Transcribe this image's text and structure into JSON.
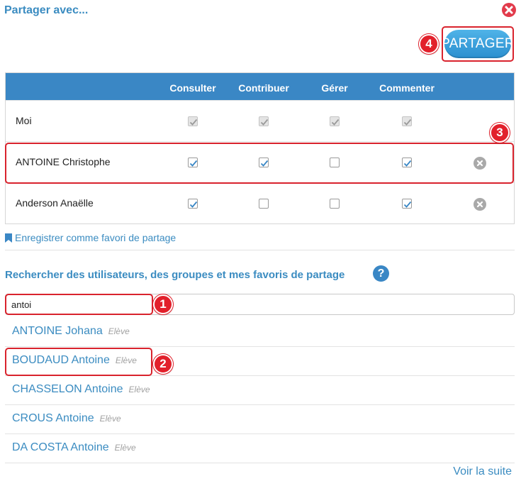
{
  "dialog": {
    "title": "Partager avec...",
    "share_label": "PARTAGER"
  },
  "table": {
    "columns": [
      "Consulter",
      "Contribuer",
      "Gérer",
      "Commenter"
    ],
    "rows": [
      {
        "name": "Moi",
        "perms": [
          true,
          true,
          true,
          true
        ],
        "disabled": true,
        "removable": false
      },
      {
        "name": "ANTOINE Christophe",
        "perms": [
          true,
          true,
          false,
          true
        ],
        "disabled": false,
        "removable": true
      },
      {
        "name": "Anderson Anaëlle",
        "perms": [
          true,
          false,
          false,
          true
        ],
        "disabled": false,
        "removable": true
      }
    ]
  },
  "favorite_link": "Enregistrer comme favori de partage",
  "search": {
    "title": "Rechercher des utilisateurs, des groupes et mes favoris de partage",
    "help": "?",
    "value": "antoi"
  },
  "results": [
    {
      "name": "ANTOINE Johana",
      "type": "Elève"
    },
    {
      "name": "BOUDAUD Antoine",
      "type": "Elève"
    },
    {
      "name": "CHASSELON Antoine",
      "type": "Elève"
    },
    {
      "name": "CROUS Antoine",
      "type": "Elève"
    },
    {
      "name": "DA COSTA Antoine",
      "type": "Elève"
    }
  ],
  "more_label": "Voir la suite",
  "annotations": [
    "1",
    "2",
    "3",
    "4"
  ],
  "colors": {
    "accent": "#3b8cc1",
    "header": "#3a87c5",
    "annotation": "#e2202b",
    "close": "#e23b4b"
  }
}
